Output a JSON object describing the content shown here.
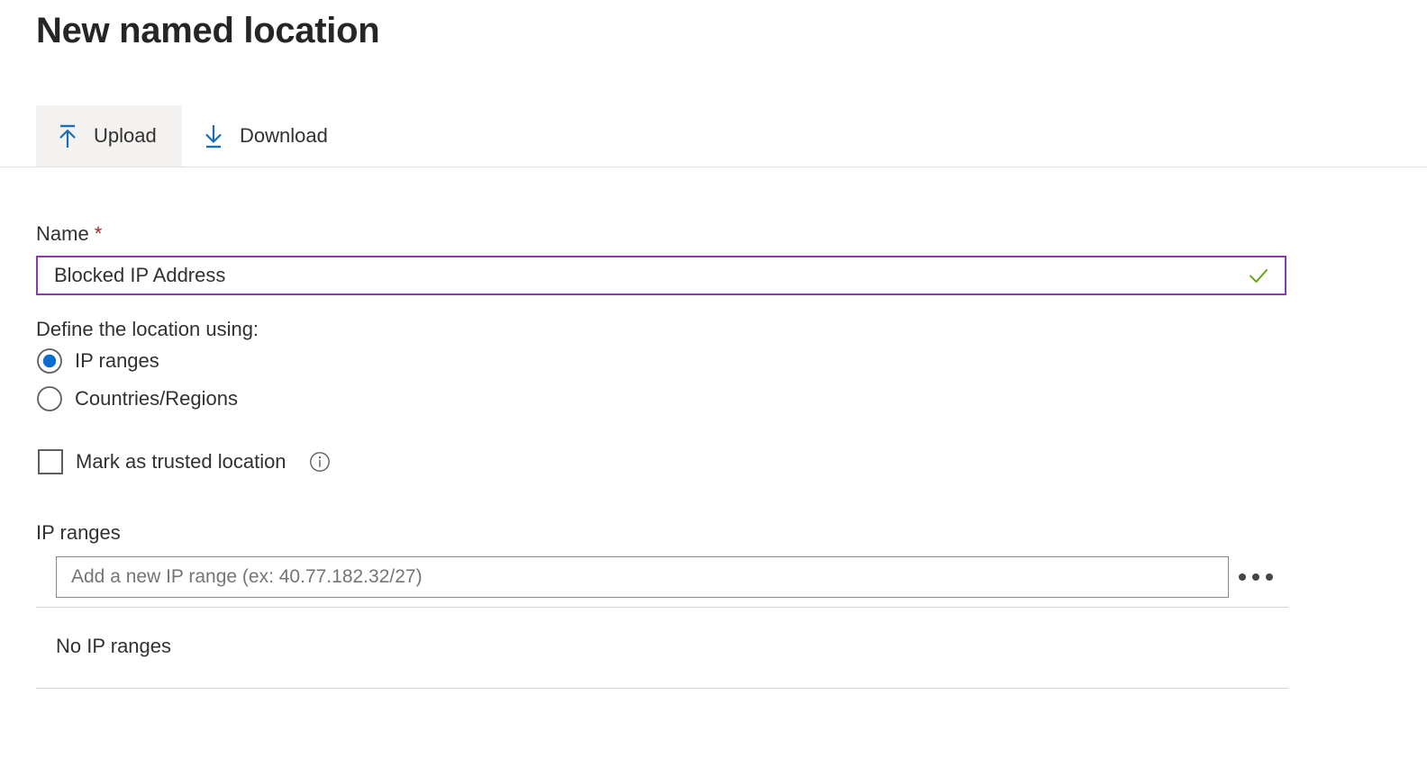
{
  "page": {
    "title": "New named location"
  },
  "toolbar": {
    "upload": {
      "label": "Upload",
      "icon": "upload-icon",
      "selected": true
    },
    "download": {
      "label": "Download",
      "icon": "download-icon",
      "selected": false
    }
  },
  "form": {
    "name": {
      "label": "Name",
      "required_marker": "*",
      "value": "Blocked IP Address",
      "placeholder": "",
      "valid": true,
      "validation_icon": "checkmark-icon",
      "border_color": "#8c3bae",
      "validation_color": "#5ba300"
    },
    "define_location": {
      "label": "Define the location using:",
      "selected": "IP ranges",
      "options": [
        {
          "label": "IP ranges",
          "selected": true
        },
        {
          "label": "Countries/Regions",
          "selected": false
        }
      ],
      "radio_color": "#0a6ed1"
    },
    "trusted": {
      "label": "Mark as trusted location",
      "checked": false,
      "info_icon": "info-icon"
    },
    "ip_ranges": {
      "label": "IP ranges",
      "input_value": "",
      "input_placeholder": "Add a new IP range (ex: 40.77.182.32/27)",
      "more_actions_label": "More actions",
      "empty_text": "No IP ranges",
      "items": []
    }
  },
  "colors": {
    "accent_blue": "#1b6eb4",
    "text_primary": "#323130",
    "title": "#262626",
    "required_red": "#a4262c",
    "divider": "#e1e1e1"
  }
}
